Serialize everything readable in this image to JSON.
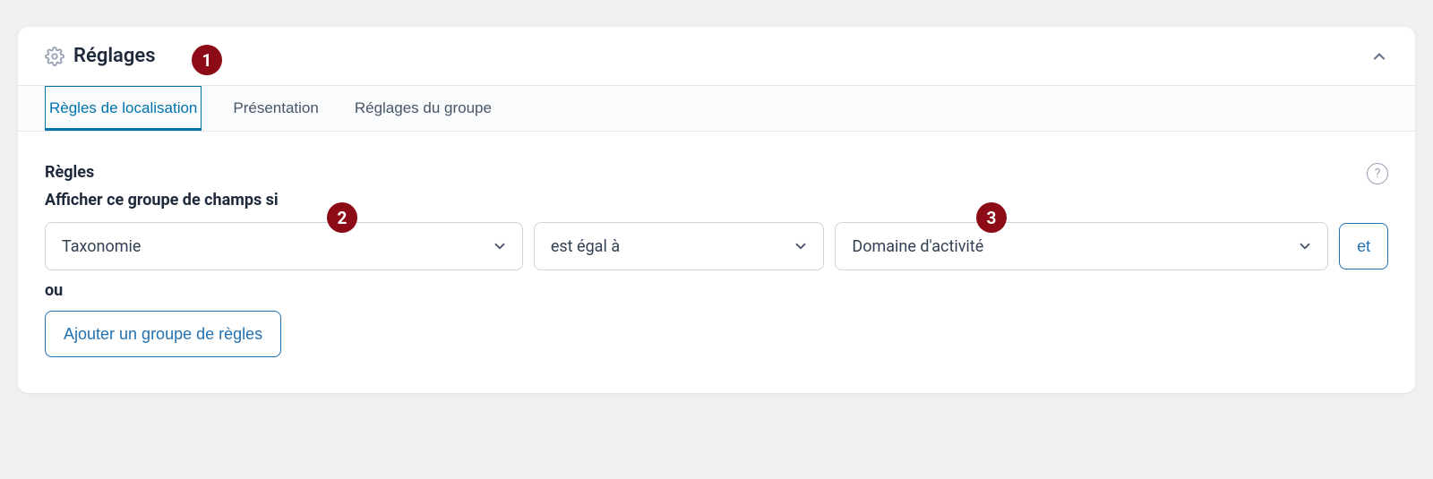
{
  "header": {
    "title": "Réglages"
  },
  "tabs": {
    "location_rules": "Règles de localisation",
    "presentation": "Présentation",
    "group_settings": "Réglages du groupe"
  },
  "body": {
    "rules_label": "Règles",
    "rules_description": "Afficher ce groupe de champs si",
    "rule": {
      "param": "Taxonomie",
      "operator": "est égal à",
      "value": "Domaine d'activité"
    },
    "and_button": "et",
    "or_label": "ou",
    "add_rule_group": "Ajouter un groupe de règles"
  },
  "annotations": {
    "a1": "1",
    "a2": "2",
    "a3": "3"
  }
}
